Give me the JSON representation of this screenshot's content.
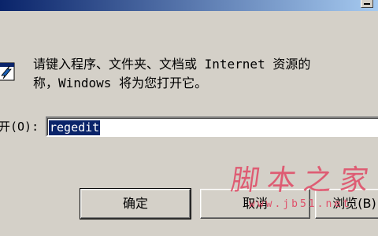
{
  "dialog": {
    "instruction_line_1": "请键入程序、文件夹、文档或 Internet 资源的",
    "instruction_line_2": "称，Windows 将为您打开它。"
  },
  "open_field": {
    "label": "开(O):",
    "value": "regedit"
  },
  "buttons": {
    "ok_label": "确定",
    "cancel_label": "取消",
    "browse_label": "浏览(B)"
  },
  "watermark": {
    "text": "脚本之家",
    "url": "www.jb51.net"
  },
  "icons": {
    "run": "run-icon",
    "dropdown": "chevron-down-icon"
  },
  "colors": {
    "window_face": "#d4d0c8",
    "selection": "#0a246a",
    "watermark": "#e0506a"
  }
}
